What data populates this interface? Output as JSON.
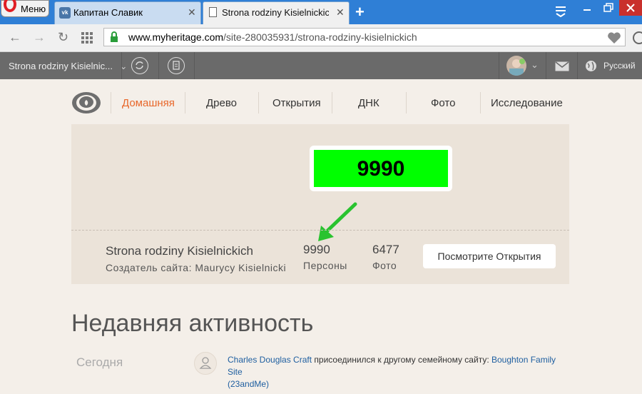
{
  "browser": {
    "menu_label": "Меню",
    "tabs": [
      {
        "title": "Капитан Славик",
        "icon": "vk-icon"
      },
      {
        "title": "Strona rodziny Kisielnickich -",
        "icon": "document-icon"
      }
    ],
    "url_host": "www.myheritage.com",
    "url_path": "/site-280035931/strona-rodziny-kisielnickich"
  },
  "site_nav": {
    "site_name": "Strona rodziny Kisielnic...",
    "language": "Русский"
  },
  "main_nav": {
    "items": [
      "Домашняя",
      "Древо",
      "Открытия",
      "ДНК",
      "Фото",
      "Исследование"
    ],
    "active_color": "#e8672a"
  },
  "hero": {
    "highlight_number": "9990",
    "highlight_color": "#00ff00",
    "site_title": "Strona rodziny Kisielnickich",
    "creator": "Создатель сайта: Maurycy Kisielnicki",
    "stats": [
      {
        "value": "9990",
        "label": "Персоны"
      },
      {
        "value": "6477",
        "label": "Фото"
      }
    ],
    "view_button": "Посмотрите Открытия"
  },
  "activity": {
    "heading": "Недавняя активность",
    "day_label": "Сегодня",
    "entry": {
      "person": "Charles Douglas Craft",
      "action": " присоединился к другому семейному сайту: ",
      "site": "Boughton Family Site",
      "site_suffix": "(23andMe)"
    }
  }
}
